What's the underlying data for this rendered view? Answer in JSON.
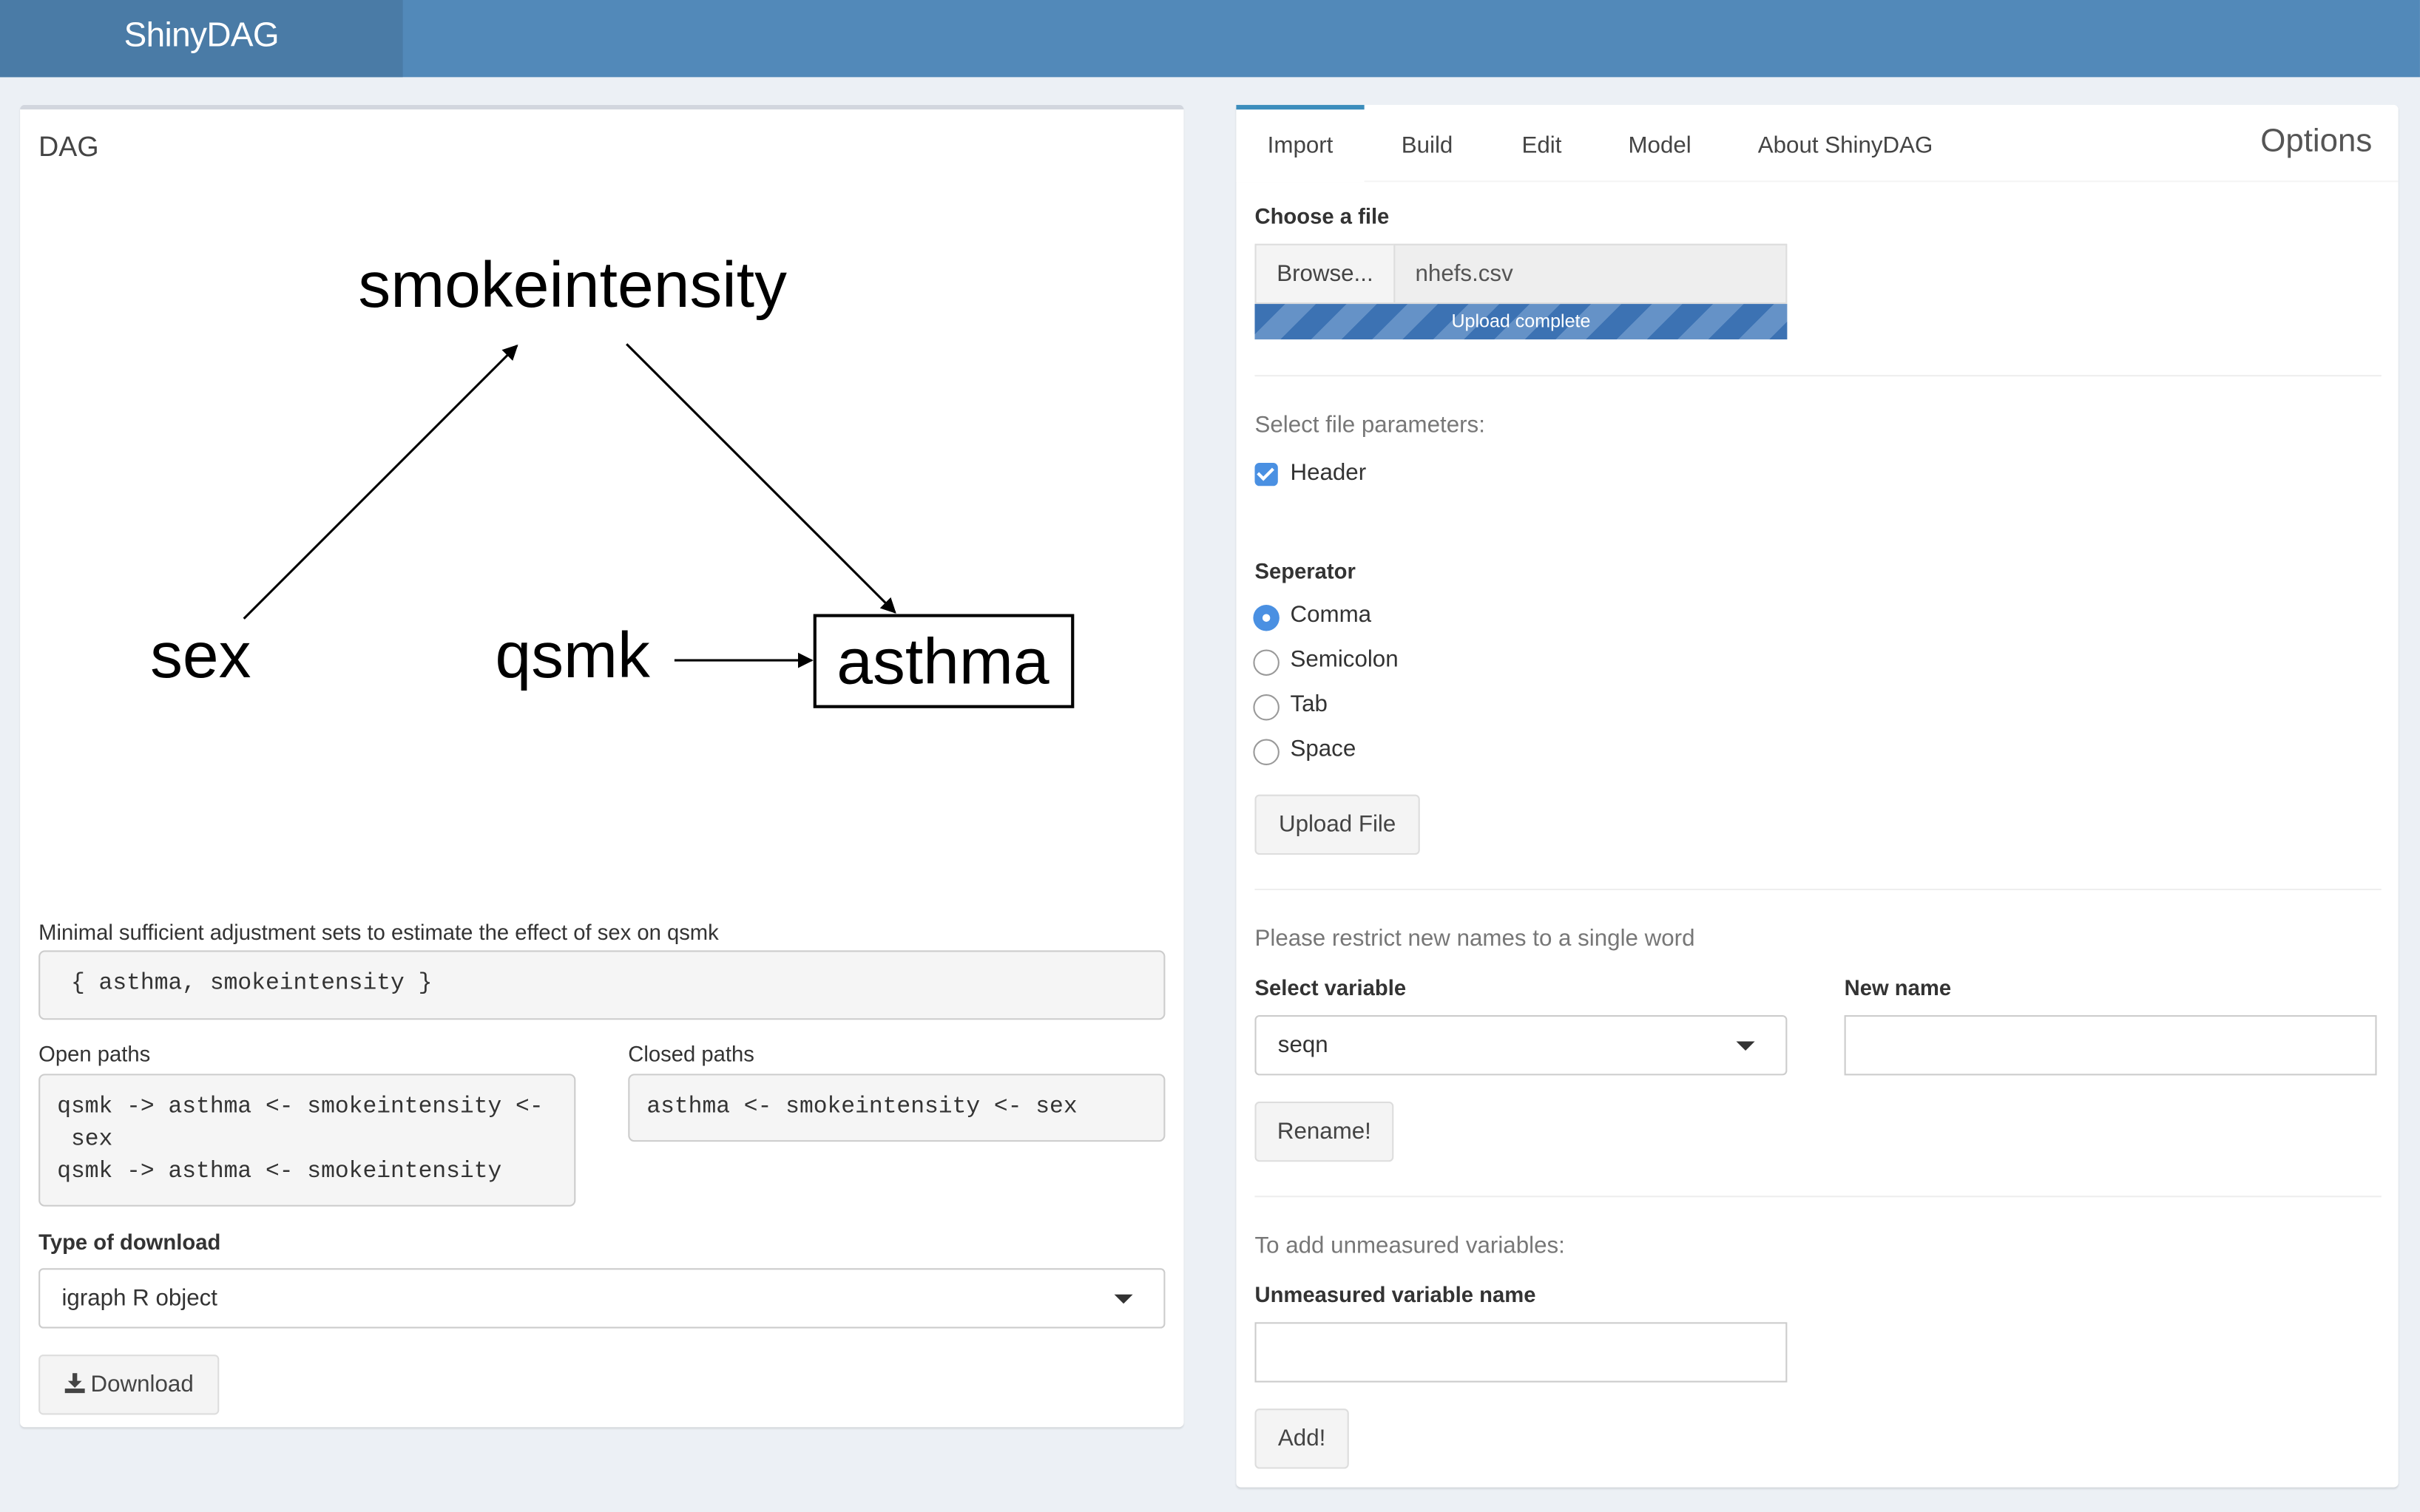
{
  "app": {
    "title": "ShinyDAG"
  },
  "colors": {
    "header": "#5289b9",
    "logo_bg": "#4a7ba6",
    "accent": "#3c8dbc",
    "checkbox": "#4a90e2"
  },
  "left": {
    "title": "DAG",
    "dag": {
      "nodes": [
        {
          "id": "smokeintensity",
          "label": "smokeintensity",
          "boxed": false
        },
        {
          "id": "sex",
          "label": "sex",
          "boxed": false
        },
        {
          "id": "qsmk",
          "label": "qsmk",
          "boxed": false
        },
        {
          "id": "asthma",
          "label": "asthma",
          "boxed": true
        }
      ],
      "edges": [
        {
          "from": "sex",
          "to": "smokeintensity"
        },
        {
          "from": "smokeintensity",
          "to": "asthma"
        },
        {
          "from": "qsmk",
          "to": "asthma"
        }
      ]
    },
    "adjustment_label": "Minimal sufficient adjustment sets to estimate the effect of sex on qsmk",
    "adjustment_value": " { asthma, smokeintensity }",
    "open_paths_label": "Open paths",
    "open_paths_value": "qsmk -> asthma <- smokeintensity <-\n sex\nqsmk -> asthma <- smokeintensity",
    "closed_paths_label": "Closed paths",
    "closed_paths_value": "asthma <- smokeintensity <- sex",
    "download_type_label": "Type of download",
    "download_type_value": "igraph R object",
    "download_button": "Download"
  },
  "right": {
    "tabs": [
      "Import",
      "Build",
      "Edit",
      "Model",
      "About ShinyDAG"
    ],
    "active_tab": "Import",
    "options_title": "Options",
    "choose_file_label": "Choose a file",
    "browse_label": "Browse...",
    "file_name": "nhefs.csv",
    "upload_status": "Upload complete",
    "upload_progress": 1.0,
    "file_params_label": "Select file parameters:",
    "header_checkbox_label": "Header",
    "header_checked": true,
    "separator_label": "Seperator",
    "separator_options": [
      "Comma",
      "Semicolon",
      "Tab",
      "Space"
    ],
    "separator_selected": "Comma",
    "upload_button": "Upload File",
    "rename_hint": "Please restrict new names to a single word",
    "select_variable_label": "Select variable",
    "select_variable_value": "seqn",
    "new_name_label": "New name",
    "new_name_value": "",
    "rename_button": "Rename!",
    "unmeasured_hint": "To add unmeasured variables:",
    "unmeasured_label": "Unmeasured variable name",
    "unmeasured_value": "",
    "add_button": "Add!"
  }
}
